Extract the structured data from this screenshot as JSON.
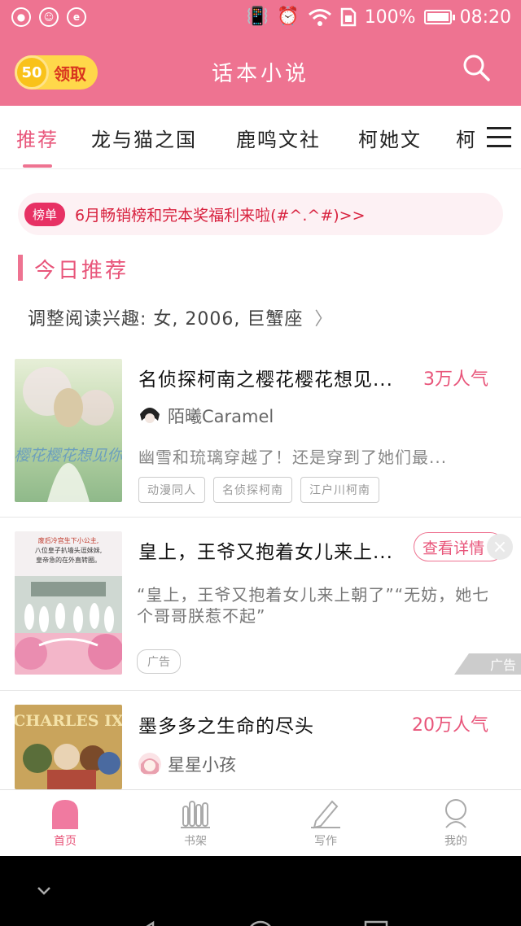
{
  "status_bar": {
    "left_icons": [
      "app-icon-1",
      "app-icon-2",
      "app-icon-3"
    ],
    "battery_percent": "100%",
    "time": "08:20"
  },
  "header": {
    "coin_value": "50",
    "claim_label": "领取",
    "title": "话本小说",
    "accent_color": "#ee7391"
  },
  "tabs": {
    "items": [
      "推荐",
      "龙与猫之国",
      "鹿鸣文社",
      "柯她文",
      "柯"
    ],
    "active_index": 0
  },
  "notice": {
    "badge": "榜单",
    "text": "6月畅销榜和完本奖福利来啦(#^.^#)>>"
  },
  "section": {
    "title": "今日推荐",
    "interest_text": "调整阅读兴趣: 女, 2006, 巨蟹座"
  },
  "books": [
    {
      "title": "名侦探柯南之樱花樱花想见...",
      "popularity": "3万人气",
      "author": "陌曦Caramel",
      "description": "幽雪和琉璃穿越了！还是穿到了她们最...",
      "tags": [
        "动漫同人",
        "名侦探柯南",
        "江户川柯南"
      ],
      "cover_text": "樱花樱花想见你"
    },
    {
      "title": "皇上，王爷又抱着女儿来上...",
      "detail_button": "查看详情",
      "description": "“皇上，王爷又抱着女儿来上朝了”“无妨，她七个哥哥朕惹不起”",
      "ad_tag": "广告",
      "ad_corner": "广告",
      "cover_text_lines": [
        "废后冷宫生下小公主,",
        "八位皇子扒墙头逗妹妹,",
        "皇帝急的在外直转圈。"
      ]
    },
    {
      "title": "墨多多之生命的尽头",
      "popularity": "20万人气",
      "author": "星星小孩",
      "cover_text": "CHARLES IX"
    }
  ],
  "bottom_nav": [
    {
      "label": "首页",
      "icon": "home-icon",
      "active": true
    },
    {
      "label": "书架",
      "icon": "bookshelf-icon",
      "active": false
    },
    {
      "label": "写作",
      "icon": "pen-icon",
      "active": false
    },
    {
      "label": "我的",
      "icon": "profile-icon",
      "active": false
    }
  ],
  "system_nav": [
    "collapse-icon",
    "back-icon",
    "home-circle-icon",
    "recents-icon"
  ]
}
